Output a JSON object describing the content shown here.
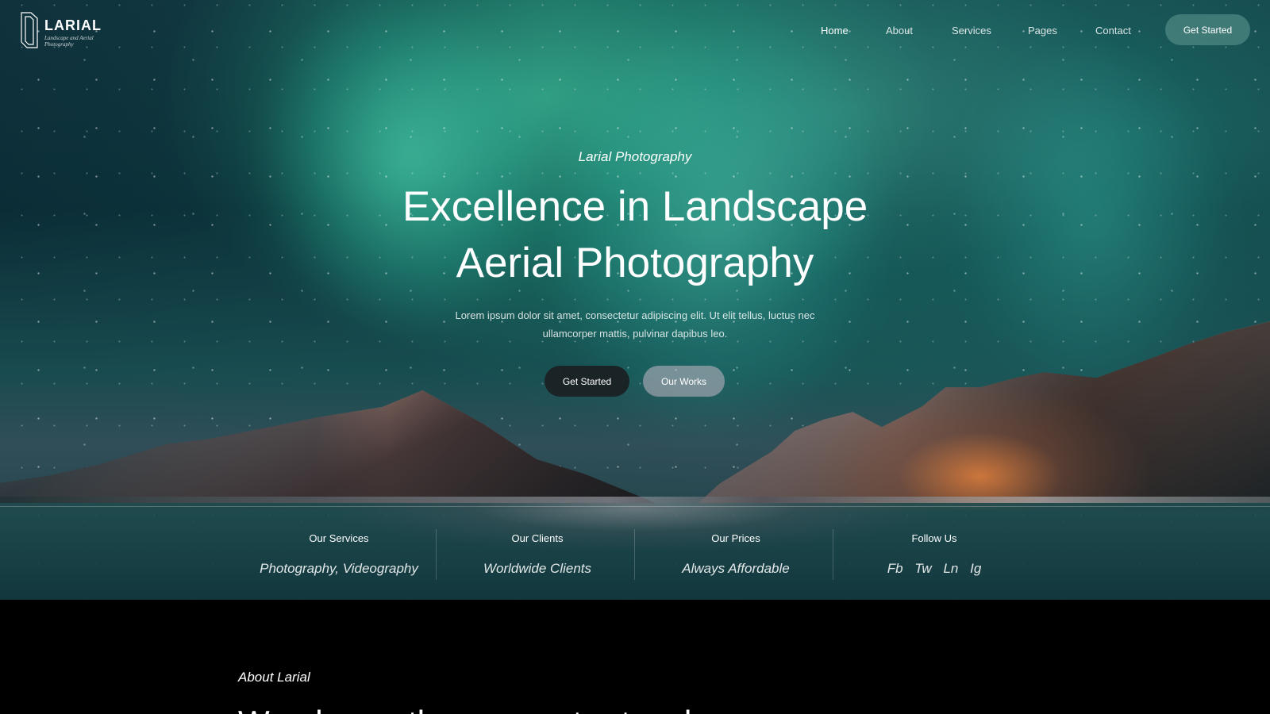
{
  "brand": {
    "name": "LARIAL",
    "tagline": "Landscape and Aerial Photography"
  },
  "navigation": {
    "items": [
      {
        "label": "Home",
        "active": true
      },
      {
        "label": "About",
        "active": false
      },
      {
        "label": "Services",
        "active": false
      },
      {
        "label": "Pages",
        "active": false
      },
      {
        "label": "Contact",
        "active": false
      }
    ],
    "cta_label": "Get Started"
  },
  "hero": {
    "eyebrow": "Larial Photography",
    "title_line_1": "Excellence in Landscape",
    "title_line_2": "Aerial Photography",
    "description": "Lorem ipsum dolor sit amet, consectetur adipiscing elit. Ut elit tellus, luctus nec ullamcorper mattis, pulvinar dapibus leo.",
    "primary_button": "Get Started",
    "secondary_button": "Our Works"
  },
  "highlights": [
    {
      "label": "Our Services",
      "value": "Photography, Videography"
    },
    {
      "label": "Our Clients",
      "value": "Worldwide Clients"
    },
    {
      "label": "Our Prices",
      "value": "Always Affordable"
    },
    {
      "label": "Follow Us",
      "socials": [
        "Fb",
        "Tw",
        "Ln",
        "Ig"
      ]
    }
  ],
  "about": {
    "kicker": "About Larial",
    "heading_partial": "We always the encounter touch"
  },
  "icons": {
    "logo": "photo-frame-logo-icon"
  },
  "colors": {
    "nav_button": "#508984",
    "primary_button": "#1a2224",
    "secondary_button": "#c4b8c4",
    "aurora": "#4ae6b0",
    "page_background": "#000000"
  }
}
